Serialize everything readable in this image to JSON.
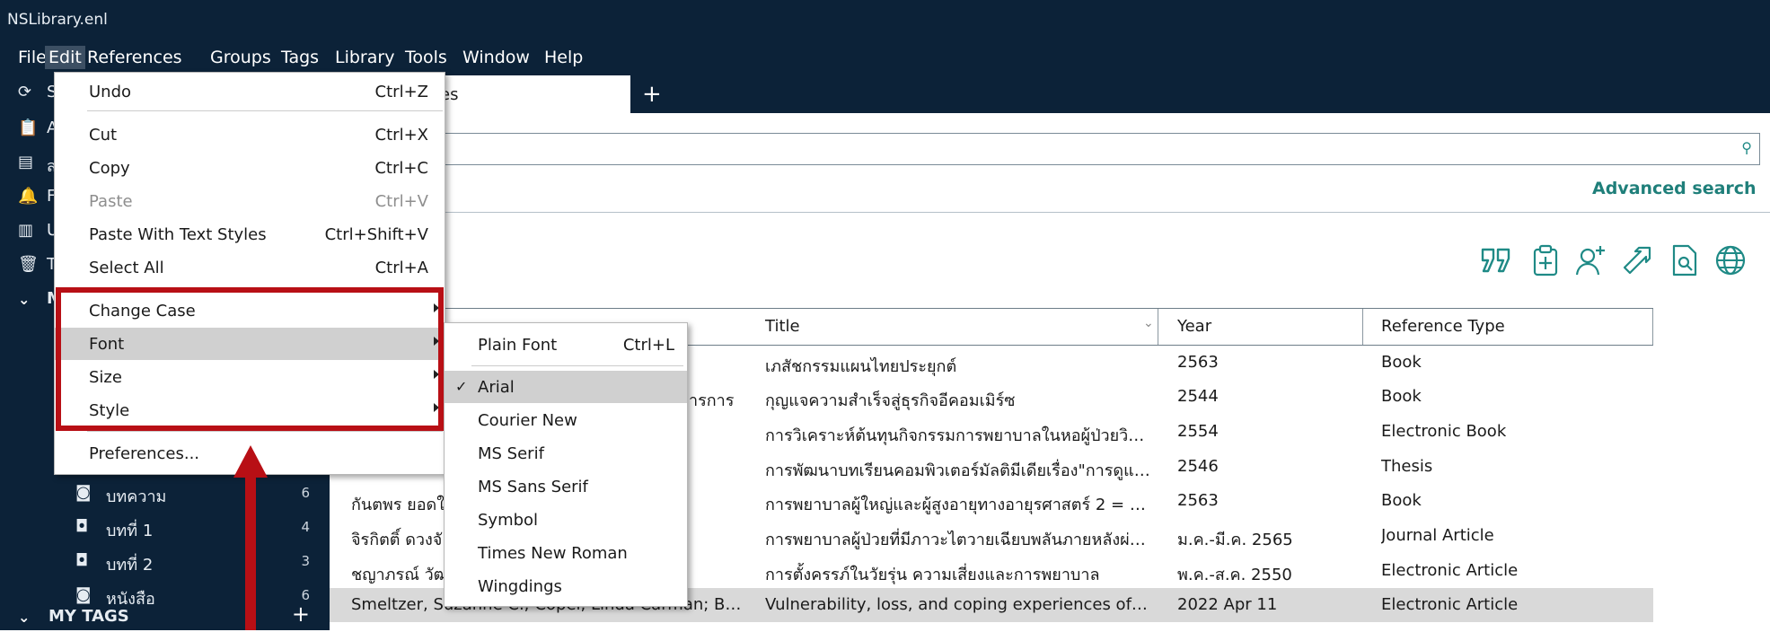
{
  "window": {
    "title": "NSLibrary.enl"
  },
  "menubar": {
    "items": [
      "File",
      "Edit",
      "References",
      "Groups",
      "Tags",
      "Library",
      "Tools",
      "Window",
      "Help"
    ]
  },
  "sidebar": {
    "sync_initial": "S",
    "row_initials": [
      "A",
      "ส",
      "F",
      "U",
      "T"
    ],
    "my_groups_initial": "M",
    "groups": [
      {
        "label": "บทความ",
        "count": "6"
      },
      {
        "label": "บทที่ 1",
        "count": "4"
      },
      {
        "label": "บทที่ 2",
        "count": "3"
      },
      {
        "label": "หนังสือ",
        "count": "6"
      }
    ],
    "my_tags": "MY TAGS",
    "add_symbol": "+"
  },
  "tabs": {
    "active_label_fragment": "es",
    "add_symbol": "+"
  },
  "search": {
    "advanced_label": "Advanced search"
  },
  "list": {
    "heading_fragment": "nces",
    "subheading_fragment": "es"
  },
  "table": {
    "columns": [
      "Title",
      "Year",
      "Reference Type"
    ],
    "rows": [
      {
        "author": "",
        "title": "เภสัชกรรมแผนไทยประยุกต์",
        "year": "2563",
        "type": "Book"
      },
      {
        "author": "ารการ",
        "title": "กุญแจความสำเร็จสู่ธุรกิจอีคอมเมิร์ซ",
        "year": "2544",
        "type": "Book"
      },
      {
        "author": "",
        "title": "การวิเคราะห์ต้นทุนกิจกรรมการพยาบาลในหอผู้ป่วยวิกฤ...",
        "year": "2554",
        "type": "Electronic Book"
      },
      {
        "author": "",
        "title": "การพัฒนาบทเรียนคอมพิวเตอร์มัลติมีเดียเรื่อง\"การดูแลช...",
        "year": "2546",
        "type": "Thesis"
      },
      {
        "author": "กันตพร ยอดใ... วัฒนา...",
        "title": "การพยาบาลผู้ใหญ่และผู้สูงอายุทางอายุรศาสตร์ 2 = Nur...",
        "year": "2563",
        "type": "Book"
      },
      {
        "author": "จิรกิตติ์ ดวงจั...",
        "title": "การพยาบาลผู้ป่วยที่มีภาวะไตวายเฉียบพลันภายหลังผ่าตั...",
        "year": "ม.ค.-มี.ค. 2565",
        "type": "Journal Article"
      },
      {
        "author": "ชญาภรณ์ วัฒ...",
        "title": "การตั้งครรภ์ในวัยรุ่น ความเสี่ยงและการพยาบาล",
        "year": "พ.ค.-ส.ค. 2550",
        "type": "Electronic Article"
      },
      {
        "author": "Smeltzer, Suzanne C.; Copel, Linda Carman; Brad...",
        "title": "Vulnerability, loss, and coping experiences of he...",
        "year": "2022 Apr 11",
        "type": "Electronic Article"
      }
    ]
  },
  "edit_menu": {
    "items": [
      {
        "label": "Undo",
        "shortcut": "Ctrl+Z"
      },
      {
        "label": "Cut",
        "shortcut": "Ctrl+X"
      },
      {
        "label": "Copy",
        "shortcut": "Ctrl+C"
      },
      {
        "label": "Paste",
        "shortcut": "Ctrl+V"
      },
      {
        "label": "Paste With Text Styles",
        "shortcut": "Ctrl+Shift+V"
      },
      {
        "label": "Select All",
        "shortcut": "Ctrl+A"
      },
      {
        "label": "Change Case"
      },
      {
        "label": "Font"
      },
      {
        "label": "Size"
      },
      {
        "label": "Style"
      },
      {
        "label": "Preferences..."
      }
    ]
  },
  "font_menu": {
    "items": [
      {
        "label": "Plain Font",
        "shortcut": "Ctrl+L"
      },
      {
        "label": "Arial",
        "checked": "✓"
      },
      {
        "label": "Courier New"
      },
      {
        "label": "MS Serif"
      },
      {
        "label": "MS Sans Serif"
      },
      {
        "label": "Symbol"
      },
      {
        "label": "Times New Roman"
      },
      {
        "label": "Wingdings"
      }
    ]
  },
  "colors": {
    "dark_navy": "#0c2238",
    "teal_accent": "#1f8a86",
    "annotation_red": "#b80f15",
    "selection_gray": "#d0d0d0"
  }
}
